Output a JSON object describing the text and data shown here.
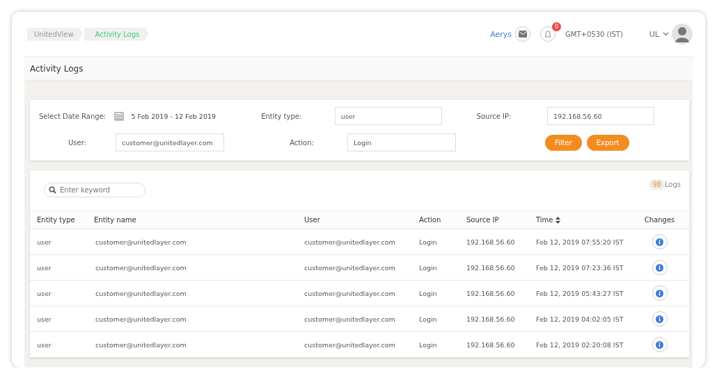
{
  "breadcrumb": [
    {
      "label": "UnitedView",
      "selected": false
    },
    {
      "label": "Activity Logs",
      "selected": true
    }
  ],
  "header": {
    "user_name": "Aerys",
    "notification_count": "0",
    "timezone": "GMT+0530 (IST)",
    "account": "UL"
  },
  "page_title": "Activity Logs",
  "filters": {
    "date_label": "Select Date Range:",
    "date_value": "5 Feb 2019 - 12 Feb 2019",
    "entity_type_label": "Entity type:",
    "entity_type_value": "user",
    "source_ip_label": "Source IP:",
    "source_ip_value": "192.168.56.60",
    "user_label": "User:",
    "user_value": "customer@unitedlayer.com",
    "action_label": "Action:",
    "action_value": "Login",
    "buttons": [
      "Filter",
      "Export"
    ]
  },
  "search": {
    "placeholder": "Enter keyword"
  },
  "log_count": {
    "count": "98",
    "label": "Logs"
  },
  "table": {
    "columns": [
      "Entity type",
      "Entity name",
      "User",
      "Action",
      "Source IP",
      "Time",
      "Changes"
    ],
    "rows": [
      [
        "user",
        "customer@unitedlayer.com",
        "customer@unitedlayer.com",
        "Login",
        "192.168.56.60",
        "Feb 12, 2019 07:55:20 IST"
      ],
      [
        "user",
        "customer@unitedlayer.com",
        "customer@unitedlayer.com",
        "Login",
        "192.168.56.60",
        "Feb 12, 2019 07:23:36 IST"
      ],
      [
        "user",
        "customer@unitedlayer.com",
        "customer@unitedlayer.com",
        "Login",
        "192.168.56.60",
        "Feb 12, 2019 05:43:27 IST"
      ],
      [
        "user",
        "customer@unitedlayer.com",
        "customer@unitedlayer.com",
        "Login",
        "192.168.56.60",
        "Feb 12, 2019 04:02:05 IST"
      ],
      [
        "user",
        "customer@unitedlayer.com",
        "customer@unitedlayer.com",
        "Login",
        "192.168.56.60",
        "Feb 12, 2019 02:20:08 IST"
      ]
    ]
  }
}
